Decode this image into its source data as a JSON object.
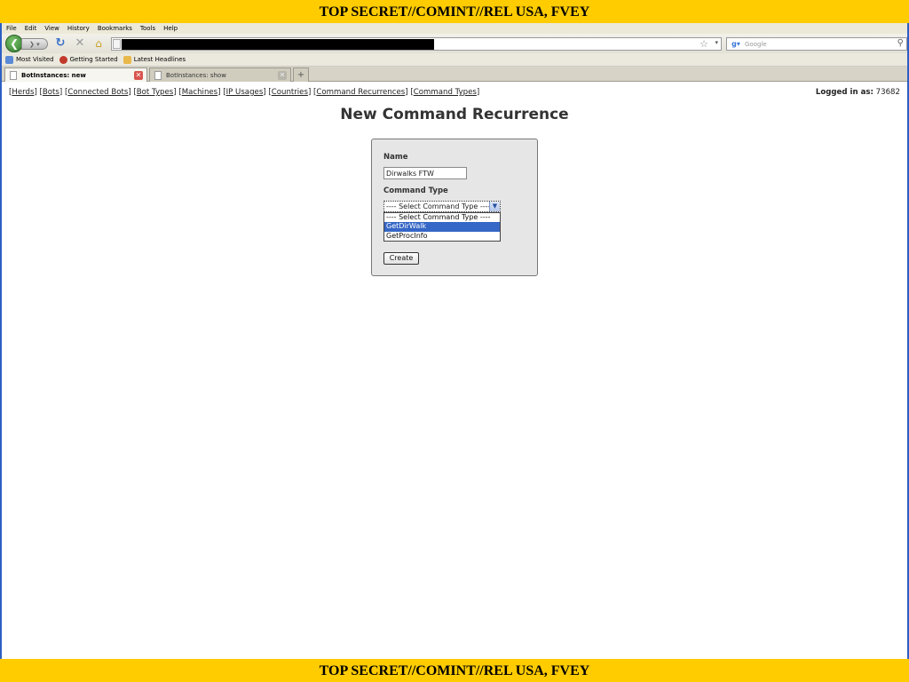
{
  "banner": {
    "top": "TOP SECRET//COMINT//REL USA, FVEY",
    "bottom": "TOP SECRET//COMINT//REL USA, FVEY"
  },
  "browser": {
    "menu": [
      "File",
      "Edit",
      "View",
      "History",
      "Bookmarks",
      "Tools",
      "Help"
    ],
    "search_placeholder": "Google",
    "bookmarks": [
      {
        "label": "Most Visited",
        "icon": "bookmark-icon",
        "color": "#5b8ad6"
      },
      {
        "label": "Getting Started",
        "icon": "firefox-icon",
        "color": "#c0392b"
      },
      {
        "label": "Latest Headlines",
        "icon": "rss-folder-icon",
        "color": "#e8b84a"
      }
    ],
    "tabs": [
      {
        "label": "BotInstances: new",
        "active": true
      },
      {
        "label": "BotInstances: show",
        "active": false
      }
    ]
  },
  "page": {
    "nav": [
      "Herds",
      "Bots",
      "Connected Bots",
      "Bot Types",
      "Machines",
      "IP Usages",
      "Countries",
      "Command Recurrences",
      "Command Types"
    ],
    "logged_in_label": "Logged in as:",
    "logged_in_user": "73682",
    "title": "New Command Recurrence",
    "form": {
      "name_label": "Name",
      "name_value": "Dirwalks FTW",
      "command_type_label": "Command Type",
      "command_type_selected": "---- Select Command Type ----",
      "command_type_options": [
        "---- Select Command Type ----",
        "GetDirWalk",
        "GetProcInfo"
      ],
      "highlighted_option": "GetDirWalk",
      "create_label": "Create"
    }
  },
  "colors": {
    "banner": "#ffcc00",
    "window_border": "#2c5fc4",
    "selection": "#3567c6"
  }
}
